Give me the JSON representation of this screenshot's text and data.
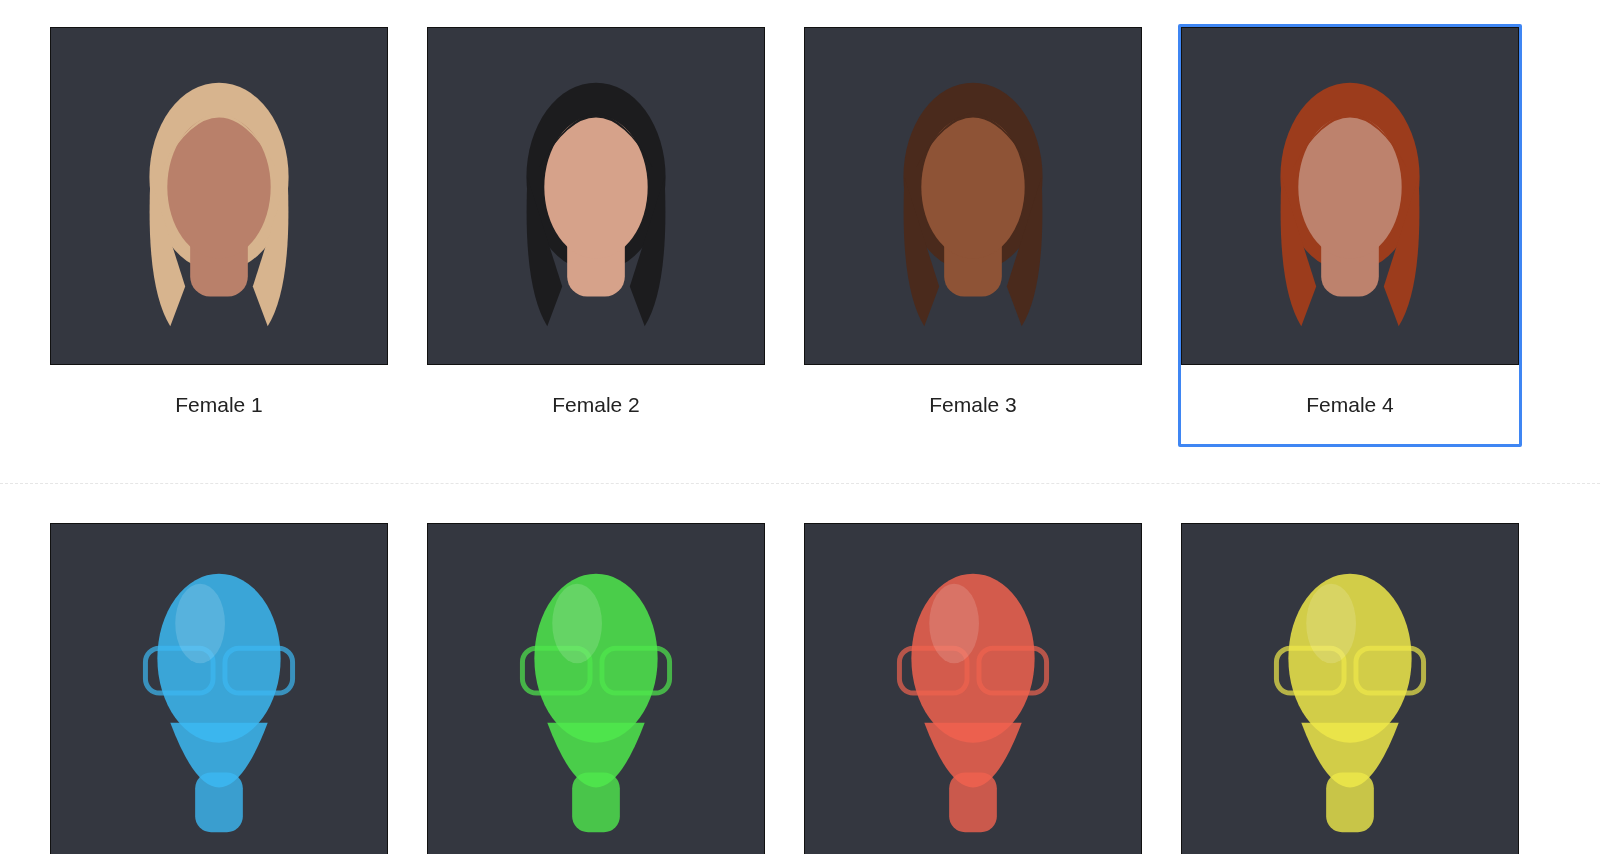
{
  "rows": [
    {
      "cards": [
        {
          "label": "Female 1",
          "selected": false
        },
        {
          "label": "Female 2",
          "selected": false
        },
        {
          "label": "Female 3",
          "selected": false
        },
        {
          "label": "Female 4",
          "selected": true
        }
      ]
    },
    {
      "cards": [
        {
          "selected": false
        },
        {
          "selected": false
        },
        {
          "selected": false
        },
        {
          "selected": false
        }
      ]
    }
  ]
}
